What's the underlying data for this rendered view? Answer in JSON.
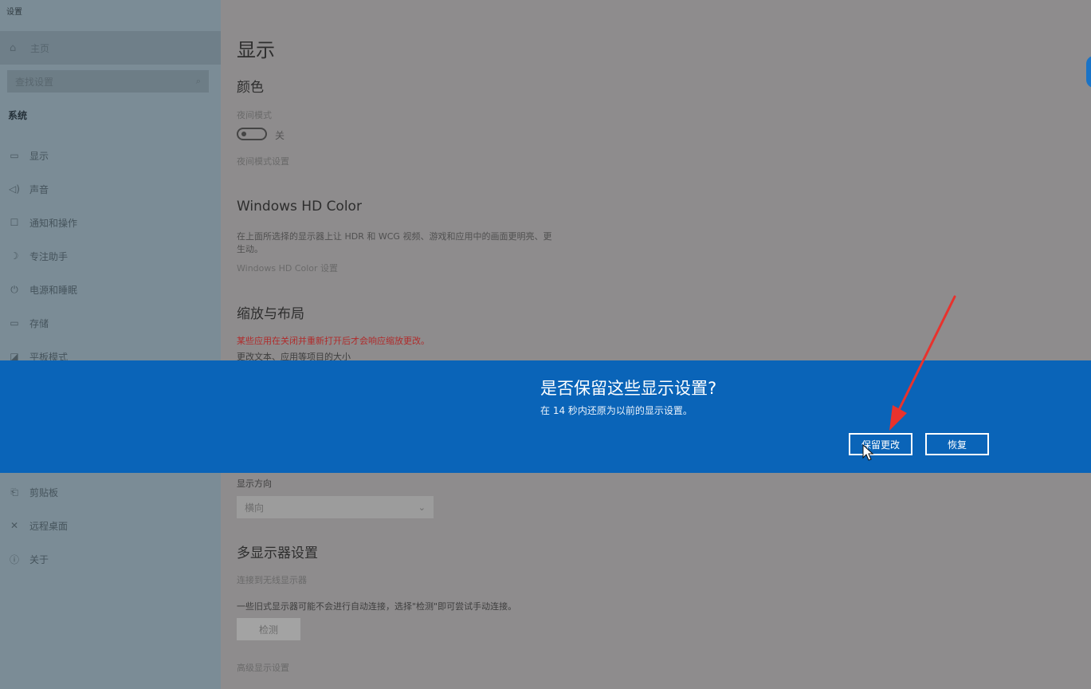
{
  "app_title": "设置",
  "sidebar": {
    "home": {
      "icon": "home-icon",
      "label": "主页"
    },
    "search_placeholder": "查找设置",
    "section": "系统",
    "items": [
      {
        "icon": "monitor-icon",
        "label": "显示"
      },
      {
        "icon": "speaker-icon",
        "label": "声音"
      },
      {
        "icon": "notification-icon",
        "label": "通知和操作"
      },
      {
        "icon": "moon-icon",
        "label": "专注助手"
      },
      {
        "icon": "power-icon",
        "label": "电源和睡眠"
      },
      {
        "icon": "storage-icon",
        "label": "存储"
      },
      {
        "icon": "tablet-icon",
        "label": "平板模式"
      },
      {
        "icon": "clipboard-icon",
        "label": "剪贴板"
      },
      {
        "icon": "remote-desktop-icon",
        "label": "远程桌面"
      },
      {
        "icon": "info-icon",
        "label": "关于"
      }
    ]
  },
  "main": {
    "title": "显示",
    "color_heading": "颜色",
    "night_light_label": "夜间模式",
    "night_light_state": "关",
    "night_light_settings_link": "夜间模式设置",
    "hdr_heading": "Windows HD Color",
    "hdr_desc": "在上面所选择的显示器上让 HDR 和 WCG 视频、游戏和应用中的画面更明亮、更生动。",
    "hdr_link": "Windows HD Color 设置",
    "scale_heading": "缩放与布局",
    "scale_warning": "某些应用在关闭并重新打开后才会响应缩放更改。",
    "scale_text_label": "更改文本、应用等项目的大小",
    "orientation_label": "显示方向",
    "orientation_value": "横向",
    "multi_heading": "多显示器设置",
    "wireless_link": "连接到无线显示器",
    "multi_desc": "一些旧式显示器可能不会进行自动连接，选择\"检测\"即可尝试手动连接。",
    "detect_button": "检测",
    "advanced_link": "高级显示设置"
  },
  "dialog": {
    "title": "是否保留这些显示设置?",
    "subtitle": "在 14 秒内还原为以前的显示设置。",
    "keep_button": "保留更改",
    "revert_button": "恢复"
  },
  "colors": {
    "dialog_band": "#0a64b8",
    "arrow": "#e8322d",
    "warning_text": "#b02b2b"
  }
}
